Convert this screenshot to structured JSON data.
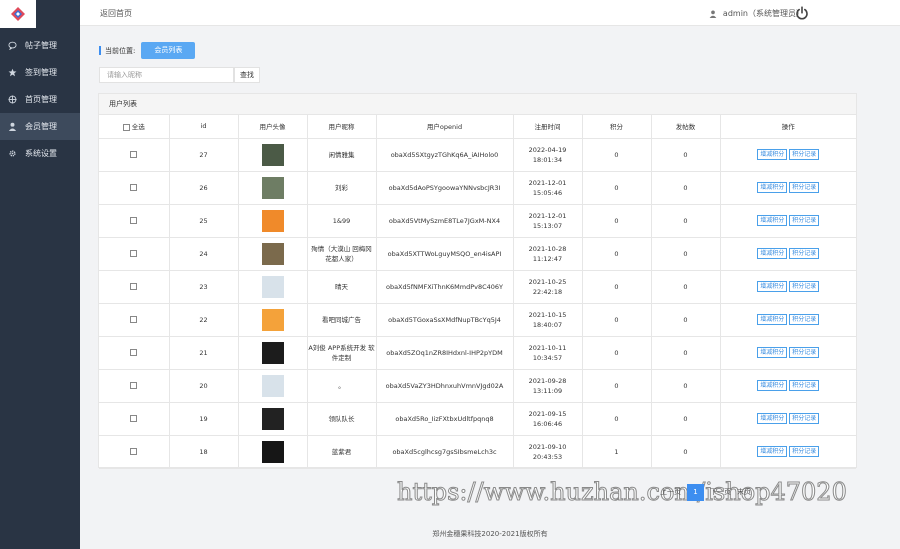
{
  "sidebar": {
    "items": [
      {
        "label": "帖子管理",
        "icon": "chat-bubble-icon",
        "active": false
      },
      {
        "label": "签到管理",
        "icon": "star-icon",
        "active": false
      },
      {
        "label": "首页管理",
        "icon": "crosshair-icon",
        "active": false
      },
      {
        "label": "会员管理",
        "icon": "user-icon",
        "active": true
      },
      {
        "label": "系统设置",
        "icon": "gear-icon",
        "active": false
      }
    ]
  },
  "topbar": {
    "back_home": "返回首页",
    "admin": "admin（系统管理员）"
  },
  "breadcrumb": {
    "label": "当前位置:",
    "current": "会员列表"
  },
  "search": {
    "placeholder": "请输入昵称",
    "button": "查找"
  },
  "panel": {
    "title": "用户列表"
  },
  "table": {
    "headers": {
      "select_all": "全选",
      "id": "id",
      "avatar": "用户头像",
      "nickname": "用户昵称",
      "openid": "用户openid",
      "reg_time": "注册时间",
      "points": "积分",
      "posts": "发帖数",
      "ops": "操作"
    },
    "op_labels": {
      "adjust": "增减积分",
      "record": "积分记录"
    },
    "rows": [
      {
        "id": "27",
        "nickname": "闲情雅集",
        "openid": "obaXd5SXtgyzTGhKq6A_iAIHolo0",
        "date": "2022-04-19",
        "time": "18:01:34",
        "points": "0",
        "posts": "0",
        "avatar_color": "#4b5a46"
      },
      {
        "id": "26",
        "nickname": "刘彩",
        "openid": "obaXd5dAoPSYgoowaYNNvsbcJR3I",
        "date": "2021-12-01",
        "time": "15:05:46",
        "points": "0",
        "posts": "0",
        "avatar_color": "#6e7d64"
      },
      {
        "id": "25",
        "nickname": "1&99",
        "openid": "obaXd5VtMySzmE8TLe7JGxM-NX4",
        "date": "2021-12-01",
        "time": "15:13:07",
        "points": "0",
        "posts": "0",
        "avatar_color": "#f08a2a"
      },
      {
        "id": "24",
        "nickname": "殉情（大漠山 回梅冈 花都人家）",
        "openid": "obaXd5XTTWoLguyMSQO_en4isAPI",
        "date": "2021-10-28",
        "time": "11:12:47",
        "points": "0",
        "posts": "0",
        "avatar_color": "#7b6a4c"
      },
      {
        "id": "23",
        "nickname": "晴天",
        "openid": "obaXd5fNMFXiThnK6MmdPv8C406Y",
        "date": "2021-10-25",
        "time": "22:42:18",
        "points": "0",
        "posts": "0",
        "avatar_color": "#d8e2ea"
      },
      {
        "id": "22",
        "nickname": "看吧同城广告",
        "openid": "obaXd5TGoxaSsXMdfNupTBcYq5J4",
        "date": "2021-10-15",
        "time": "18:40:07",
        "points": "0",
        "posts": "0",
        "avatar_color": "#f4a23a"
      },
      {
        "id": "21",
        "nickname": "A刘俊 APP系统开发 软件定制",
        "openid": "obaXd5ZOq1nZR8IHdxnl-IHP2pYDM",
        "date": "2021-10-11",
        "time": "10:34:57",
        "points": "0",
        "posts": "0",
        "avatar_color": "#1c1c1c"
      },
      {
        "id": "20",
        "nickname": "。",
        "openid": "obaXd5VaZY3HDhnxuhVmnVJgd02A",
        "date": "2021-09-28",
        "time": "13:11:09",
        "points": "0",
        "posts": "0",
        "avatar_color": "#d8e2ea"
      },
      {
        "id": "19",
        "nickname": "领队队长",
        "openid": "obaXd5Ro_IizFXtbxUdltfpqnq8",
        "date": "2021-09-15",
        "time": "16:06:46",
        "points": "0",
        "posts": "0",
        "avatar_color": "#222222"
      },
      {
        "id": "18",
        "nickname": "蓝紫君",
        "openid": "obaXd5cglhcsg7gsSIbsmeLch3c",
        "date": "2021-09-10",
        "time": "20:43:53",
        "points": "1",
        "posts": "0",
        "avatar_color": "#161616"
      }
    ]
  },
  "pager": {
    "prev": "上一页",
    "current": "1",
    "next": "下一页",
    "last": "末页"
  },
  "watermark": "https://www.huzhan.com/ishop47020",
  "footer": "郑州金穗果科技2020-2021版权所有",
  "colors": {
    "sidebar_bg": "#293444",
    "accent": "#3d8ef0",
    "tag_bg": "#5aa8f3"
  }
}
